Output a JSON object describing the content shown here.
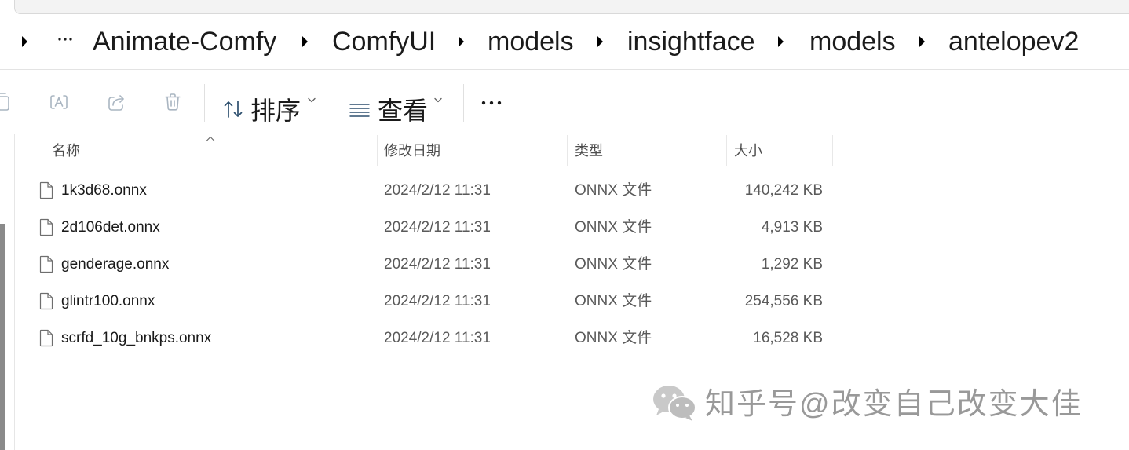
{
  "colors": {
    "accent": "#2d4f6e",
    "disabled_icon": "#a9b5c1",
    "scrollbar": "#8a8a8a",
    "watermark": "#8e8e8e"
  },
  "breadcrumb": {
    "lead_icon": "chevron-right-icon",
    "overflow_icon": "more-horizontal-icon",
    "separator_icon": "chevron-right-icon",
    "items": [
      {
        "label": "Animate-Comfy"
      },
      {
        "label": "ComfyUI"
      },
      {
        "label": "models"
      },
      {
        "label": "insightface"
      },
      {
        "label": "models"
      },
      {
        "label": "antelopev2"
      }
    ]
  },
  "toolbar": {
    "buttons": [
      {
        "icon": "copy-icon",
        "enabled": false
      },
      {
        "icon": "rename-icon",
        "enabled": false
      },
      {
        "icon": "share-icon",
        "enabled": false
      },
      {
        "icon": "delete-icon",
        "enabled": false
      }
    ],
    "sort": {
      "label": "排序",
      "icon": "sort-icon",
      "dropdown_icon": "chevron-down-icon"
    },
    "view": {
      "label": "查看",
      "icon": "view-icon",
      "dropdown_icon": "chevron-down-icon"
    },
    "more_icon": "more-horizontal-icon"
  },
  "columns": {
    "name": "名称",
    "modified": "修改日期",
    "type": "类型",
    "size": "大小",
    "sort_indicator_icon": "chevron-up-icon"
  },
  "files": [
    {
      "name": "1k3d68.onnx",
      "modified": "2024/2/12 11:31",
      "type": "ONNX 文件",
      "size": "140,242 KB"
    },
    {
      "name": "2d106det.onnx",
      "modified": "2024/2/12 11:31",
      "type": "ONNX 文件",
      "size": "4,913 KB"
    },
    {
      "name": "genderage.onnx",
      "modified": "2024/2/12 11:31",
      "type": "ONNX 文件",
      "size": "1,292 KB"
    },
    {
      "name": "glintr100.onnx",
      "modified": "2024/2/12 11:31",
      "type": "ONNX 文件",
      "size": "254,556 KB"
    },
    {
      "name": "scrfd_10g_bnkps.onnx",
      "modified": "2024/2/12 11:31",
      "type": "ONNX 文件",
      "size": "16,528 KB"
    }
  ],
  "watermark": {
    "logo_icon": "wechat-logo-icon",
    "text": "知乎号@改变自己改变大佳"
  }
}
